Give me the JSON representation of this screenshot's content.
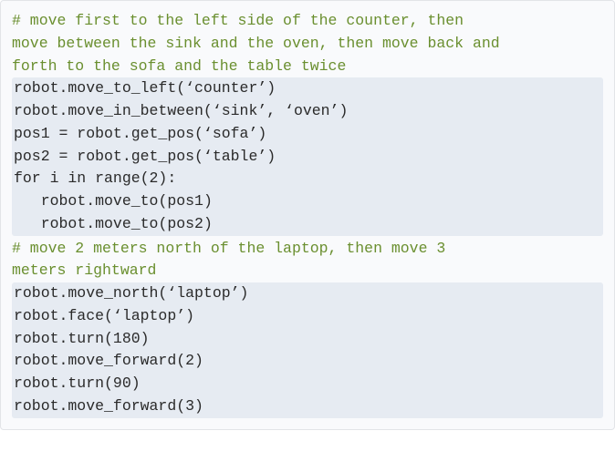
{
  "code": {
    "comment1_line1": "# move first to the left side of the counter, then",
    "comment1_line2": "move between the sink and the oven, then move back and",
    "comment1_line3": "forth to the sofa and the table twice",
    "block1_line1": "robot.move_to_left(‘counter’)",
    "block1_line2": "robot.move_in_between(‘sink’, ‘oven’)",
    "block1_line3": "pos1 = robot.get_pos(‘sofa’)",
    "block1_line4": "pos2 = robot.get_pos(‘table’)",
    "block1_line5": "for i in range(2):",
    "block1_line6": "   robot.move_to(pos1)",
    "block1_line7": "   robot.move_to(pos2)",
    "comment2_line1": "# move 2 meters north of the laptop, then move 3",
    "comment2_line2": "meters rightward",
    "block2_line1": "robot.move_north(‘laptop’)",
    "block2_line2": "robot.face(‘laptop’)",
    "block2_line3": "robot.turn(180)",
    "block2_line4": "robot.move_forward(2)",
    "block2_line5": "robot.turn(90)",
    "block2_line6": "robot.move_forward(3)"
  }
}
